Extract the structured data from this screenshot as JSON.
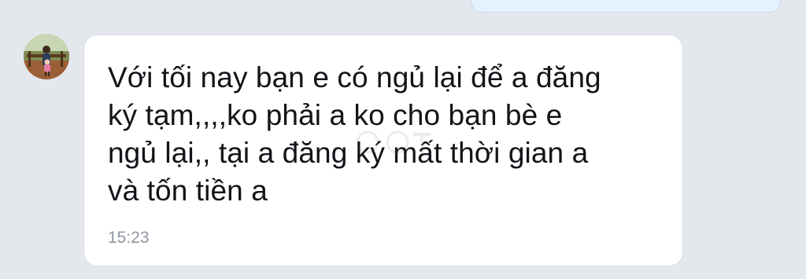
{
  "conversation": {
    "outgoing_message": {
      "text": ""
    },
    "incoming_message": {
      "lines": [
        "Với tối nay bạn e có ngủ lại để a đăng",
        "ký tạm,,,,ko phải a ko cho bạn bè e",
        "ngủ lại,, tại a đăng ký mất thời gian a",
        "và tốn tiền a"
      ],
      "time": "15:23"
    },
    "avatar": {
      "icon": "user-avatar-photo"
    }
  },
  "colors": {
    "background": "#e4e8ed",
    "incoming_bubble": "#ffffff",
    "outgoing_bubble": "#e5f1ff",
    "text": "#111418",
    "timestamp": "#8e96a0"
  }
}
